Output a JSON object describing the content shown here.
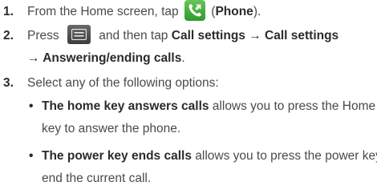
{
  "steps": [
    {
      "number": "1.",
      "text_before": "From the Home screen, tap ",
      "icon": "phone-app-icon",
      "text_after_open": " (",
      "bold": "Phone",
      "text_after_close": ")."
    },
    {
      "number": "2.",
      "text_before": "Press ",
      "icon": "menu-key-icon",
      "text_mid": " and then tap ",
      "bold_1": "Call settings → Call settings",
      "bold_2": "→ Answering/ending calls",
      "end": "."
    },
    {
      "number": "3.",
      "text": "Select any of the following options:"
    }
  ],
  "options": [
    {
      "bullet": "•",
      "bold": "The home key answers calls",
      "text_1": " allows you to press the Home",
      "text_2": "key to answer the phone."
    },
    {
      "bullet": "•",
      "bold": "The power key ends calls",
      "text_1": " allows you to press the power key to",
      "text_2": "end the current call."
    }
  ],
  "colors": {
    "text": "#4a4a4a",
    "bold_text": "#2b2b2b",
    "phone_icon": "#3fae36",
    "menu_icon": "#4a4a4a"
  }
}
